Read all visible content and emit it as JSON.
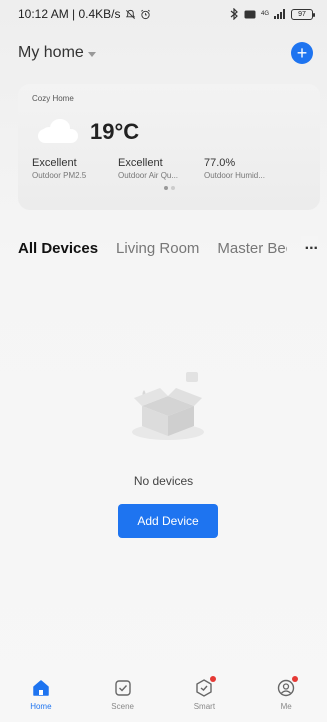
{
  "status_bar": {
    "time_info": "10:12 AM | 0.4KB/s",
    "signal": "4G",
    "battery": "97"
  },
  "header": {
    "home_name": "My home"
  },
  "weather": {
    "title": "Cozy Home",
    "temperature": "19°C",
    "metrics": [
      {
        "value": "Excellent",
        "label": "Outdoor PM2.5"
      },
      {
        "value": "Excellent",
        "label": "Outdoor Air Qu..."
      },
      {
        "value": "77.0%",
        "label": "Outdoor Humid..."
      }
    ]
  },
  "tabs": {
    "items": [
      "All Devices",
      "Living Room",
      "Master Bec"
    ],
    "more": "..."
  },
  "empty_state": {
    "message": "No devices",
    "button_label": "Add Device"
  },
  "bottom_nav": {
    "items": [
      {
        "label": "Home",
        "icon": "home-icon"
      },
      {
        "label": "Scene",
        "icon": "scene-icon"
      },
      {
        "label": "Smart",
        "icon": "smart-icon"
      },
      {
        "label": "Me",
        "icon": "profile-icon"
      }
    ]
  },
  "colors": {
    "accent": "#1e74f0",
    "badge": "#e53935"
  }
}
